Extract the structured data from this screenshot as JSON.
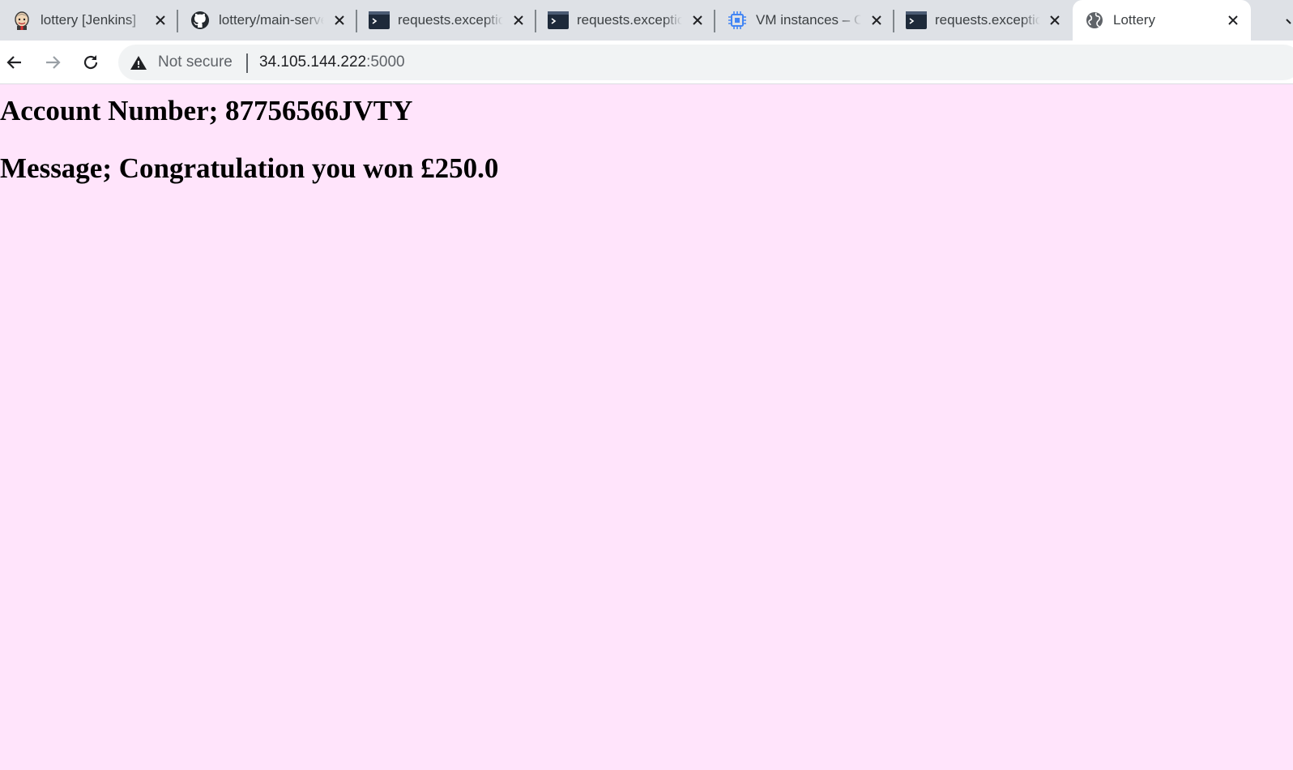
{
  "browser": {
    "tabs": [
      {
        "title": "lottery [Jenkins]",
        "icon": "jenkins-icon",
        "active": false
      },
      {
        "title": "lottery/main-server",
        "icon": "github-icon",
        "active": false
      },
      {
        "title": "requests.exceptions",
        "icon": "terminal-icon",
        "active": false
      },
      {
        "title": "requests.exceptions",
        "icon": "terminal-icon",
        "active": false
      },
      {
        "title": "VM instances – Compute Engine",
        "icon": "compute-chip-icon",
        "active": false
      },
      {
        "title": "requests.exceptions",
        "icon": "terminal-icon",
        "active": false
      },
      {
        "title": "Lottery",
        "icon": "globe-icon",
        "active": true
      }
    ],
    "omnibox": {
      "security_label": "Not secure",
      "url_host": "34.105.144.222",
      "url_port": ":5000"
    }
  },
  "page": {
    "account_line": "Account Number; 87756566JVTY",
    "message_line": "Message; Congratulation you won £250.0",
    "background_color": "#ffe4fb"
  }
}
